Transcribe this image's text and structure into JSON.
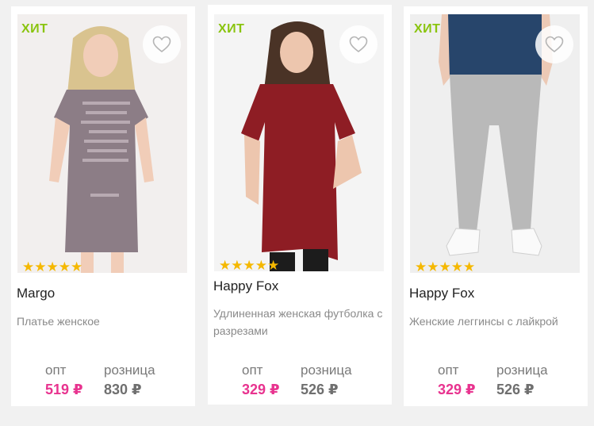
{
  "colors": {
    "hit_badge": "#8ac40f",
    "wholesale_price": "#e8338f",
    "retail_price": "#6f6f6f",
    "star": "#f5b800",
    "background": "#f1f1f1"
  },
  "products": [
    {
      "badge": "ХИТ",
      "rating": 5,
      "stars": "★★★★★",
      "brand": "Margo",
      "description": "Платье женское",
      "wholesale_label": "опт",
      "wholesale_price": "519 ₽",
      "retail_label": "розница",
      "retail_price": "830 ₽",
      "favorite_icon": "heart-outline-icon"
    },
    {
      "badge": "ХИТ",
      "rating": 5,
      "stars": "★★★★★",
      "brand": "Happy Fox",
      "description": "Удлиненная женская футболка с разрезами",
      "wholesale_label": "опт",
      "wholesale_price": "329 ₽",
      "retail_label": "розница",
      "retail_price": "526 ₽",
      "favorite_icon": "heart-outline-icon"
    },
    {
      "badge": "ХИТ",
      "rating": 5,
      "stars": "★★★★★",
      "brand": "Happy Fox",
      "description": "Женские леггинсы с лайкрой",
      "wholesale_label": "опт",
      "wholesale_price": "329 ₽",
      "retail_label": "розница",
      "retail_price": "526 ₽",
      "favorite_icon": "heart-outline-icon"
    }
  ]
}
